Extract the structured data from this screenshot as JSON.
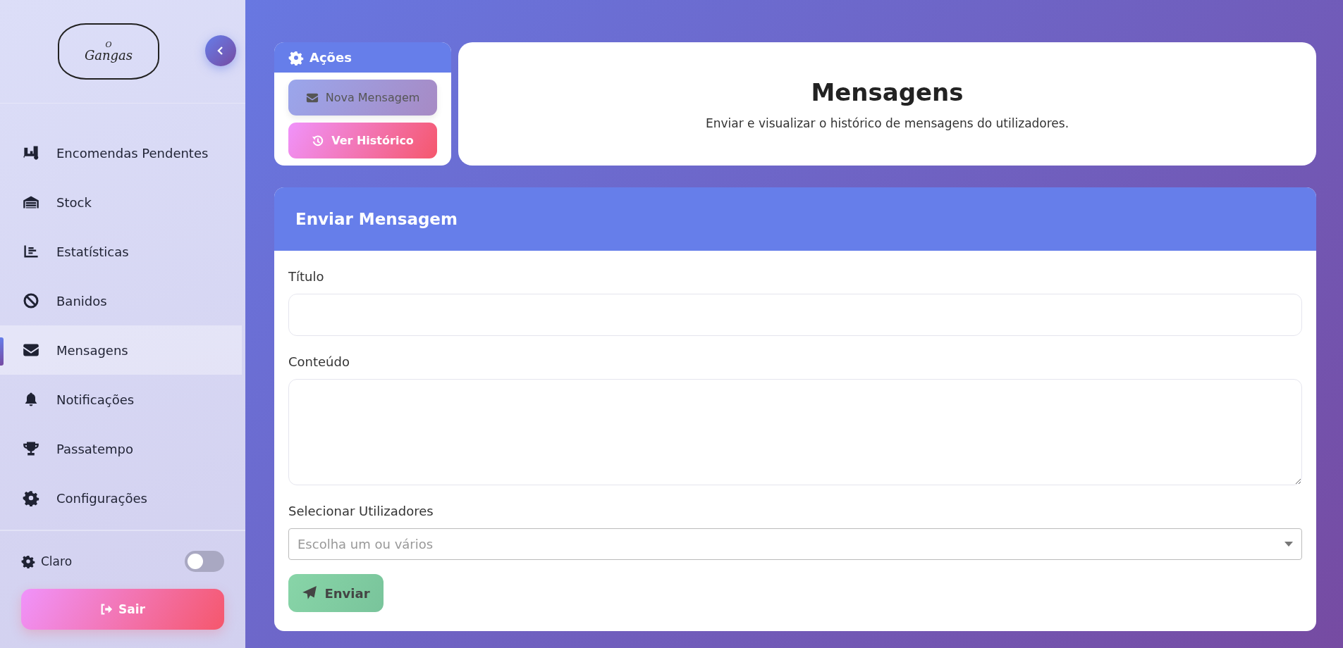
{
  "sidebar": {
    "logo": {
      "small": "O",
      "name": "Gangas"
    },
    "items": [
      {
        "label": "Encomendas Pendentes",
        "selected": false
      },
      {
        "label": "Stock",
        "selected": false
      },
      {
        "label": "Estatísticas",
        "selected": false
      },
      {
        "label": "Banidos",
        "selected": false
      },
      {
        "label": "Mensagens",
        "selected": true
      },
      {
        "label": "Notificações",
        "selected": false
      },
      {
        "label": "Passatempo",
        "selected": false
      },
      {
        "label": "Configurações",
        "selected": false
      }
    ],
    "theme": {
      "label": "Claro",
      "on": false
    },
    "logout": "Sair"
  },
  "actions": {
    "title": "Ações",
    "buttons": [
      {
        "label": "Nova Mensagem",
        "kind": "new"
      },
      {
        "label": "Ver Histórico",
        "kind": "history"
      }
    ]
  },
  "header": {
    "title": "Mensagens",
    "subtitle": "Enviar e visualizar o histórico de mensagens do utilizadores."
  },
  "form": {
    "title": "Enviar Mensagem",
    "fields": [
      {
        "label": "Título",
        "kind": "text"
      },
      {
        "label": "Conteúdo",
        "kind": "textarea"
      },
      {
        "label": "Selecionar Utilizadores",
        "kind": "select",
        "placeholder": "Escolha um ou vários"
      }
    ],
    "submit": "Enviar"
  }
}
